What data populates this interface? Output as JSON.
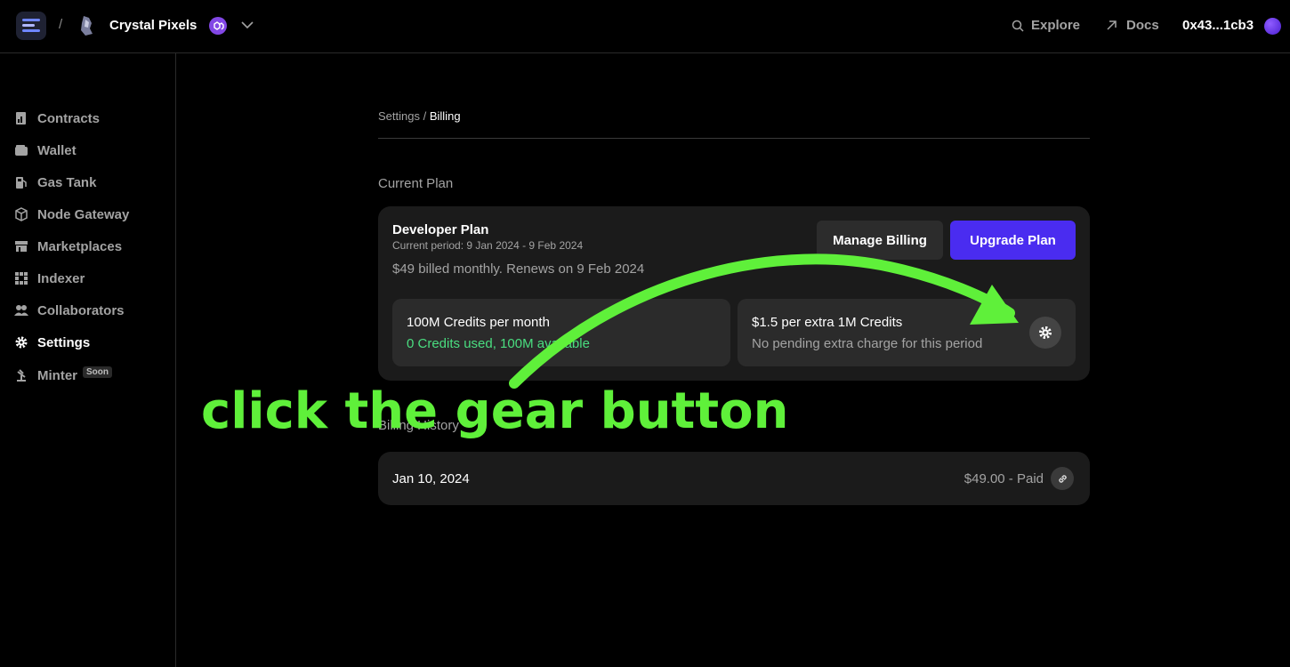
{
  "header": {
    "separator": "/",
    "project_name": "Crystal Pixels",
    "explore_label": "Explore",
    "docs_label": "Docs",
    "wallet_address": "0x43...1cb3"
  },
  "sidebar": {
    "items": [
      {
        "label": "Contracts",
        "icon": "contracts-icon"
      },
      {
        "label": "Wallet",
        "icon": "wallet-icon"
      },
      {
        "label": "Gas Tank",
        "icon": "gas-tank-icon"
      },
      {
        "label": "Node Gateway",
        "icon": "cube-icon"
      },
      {
        "label": "Marketplaces",
        "icon": "storefront-icon"
      },
      {
        "label": "Indexer",
        "icon": "grid-icon"
      },
      {
        "label": "Collaborators",
        "icon": "users-icon"
      },
      {
        "label": "Settings",
        "icon": "gear-icon",
        "active": true
      },
      {
        "label": "Minter",
        "icon": "minter-icon",
        "badge": "Soon"
      }
    ]
  },
  "breadcrumb": {
    "parent": "Settings",
    "separator": "/",
    "current": "Billing"
  },
  "current_plan": {
    "section_title": "Current Plan",
    "plan_name": "Developer Plan",
    "period": "Current period: 9 Jan 2024 - 9 Feb 2024",
    "billing": "$49 billed monthly. Renews on 9 Feb 2024",
    "manage_label": "Manage Billing",
    "upgrade_label": "Upgrade Plan",
    "credits": {
      "title": "100M Credits per month",
      "usage": "0 Credits used, 100M available"
    },
    "extra": {
      "title": "$1.5 per extra 1M Credits",
      "note": "No pending extra charge for this period"
    }
  },
  "billing_history": {
    "section_title": "Billing History",
    "rows": [
      {
        "date": "Jan 10, 2024",
        "amount": "$49.00 - Paid"
      }
    ]
  },
  "annotation": {
    "text": "click the gear button",
    "color": "#5ff03a"
  },
  "colors": {
    "accent": "#4a2cf0",
    "success": "#4ade80",
    "background": "#000000",
    "card": "#1b1b1b"
  }
}
